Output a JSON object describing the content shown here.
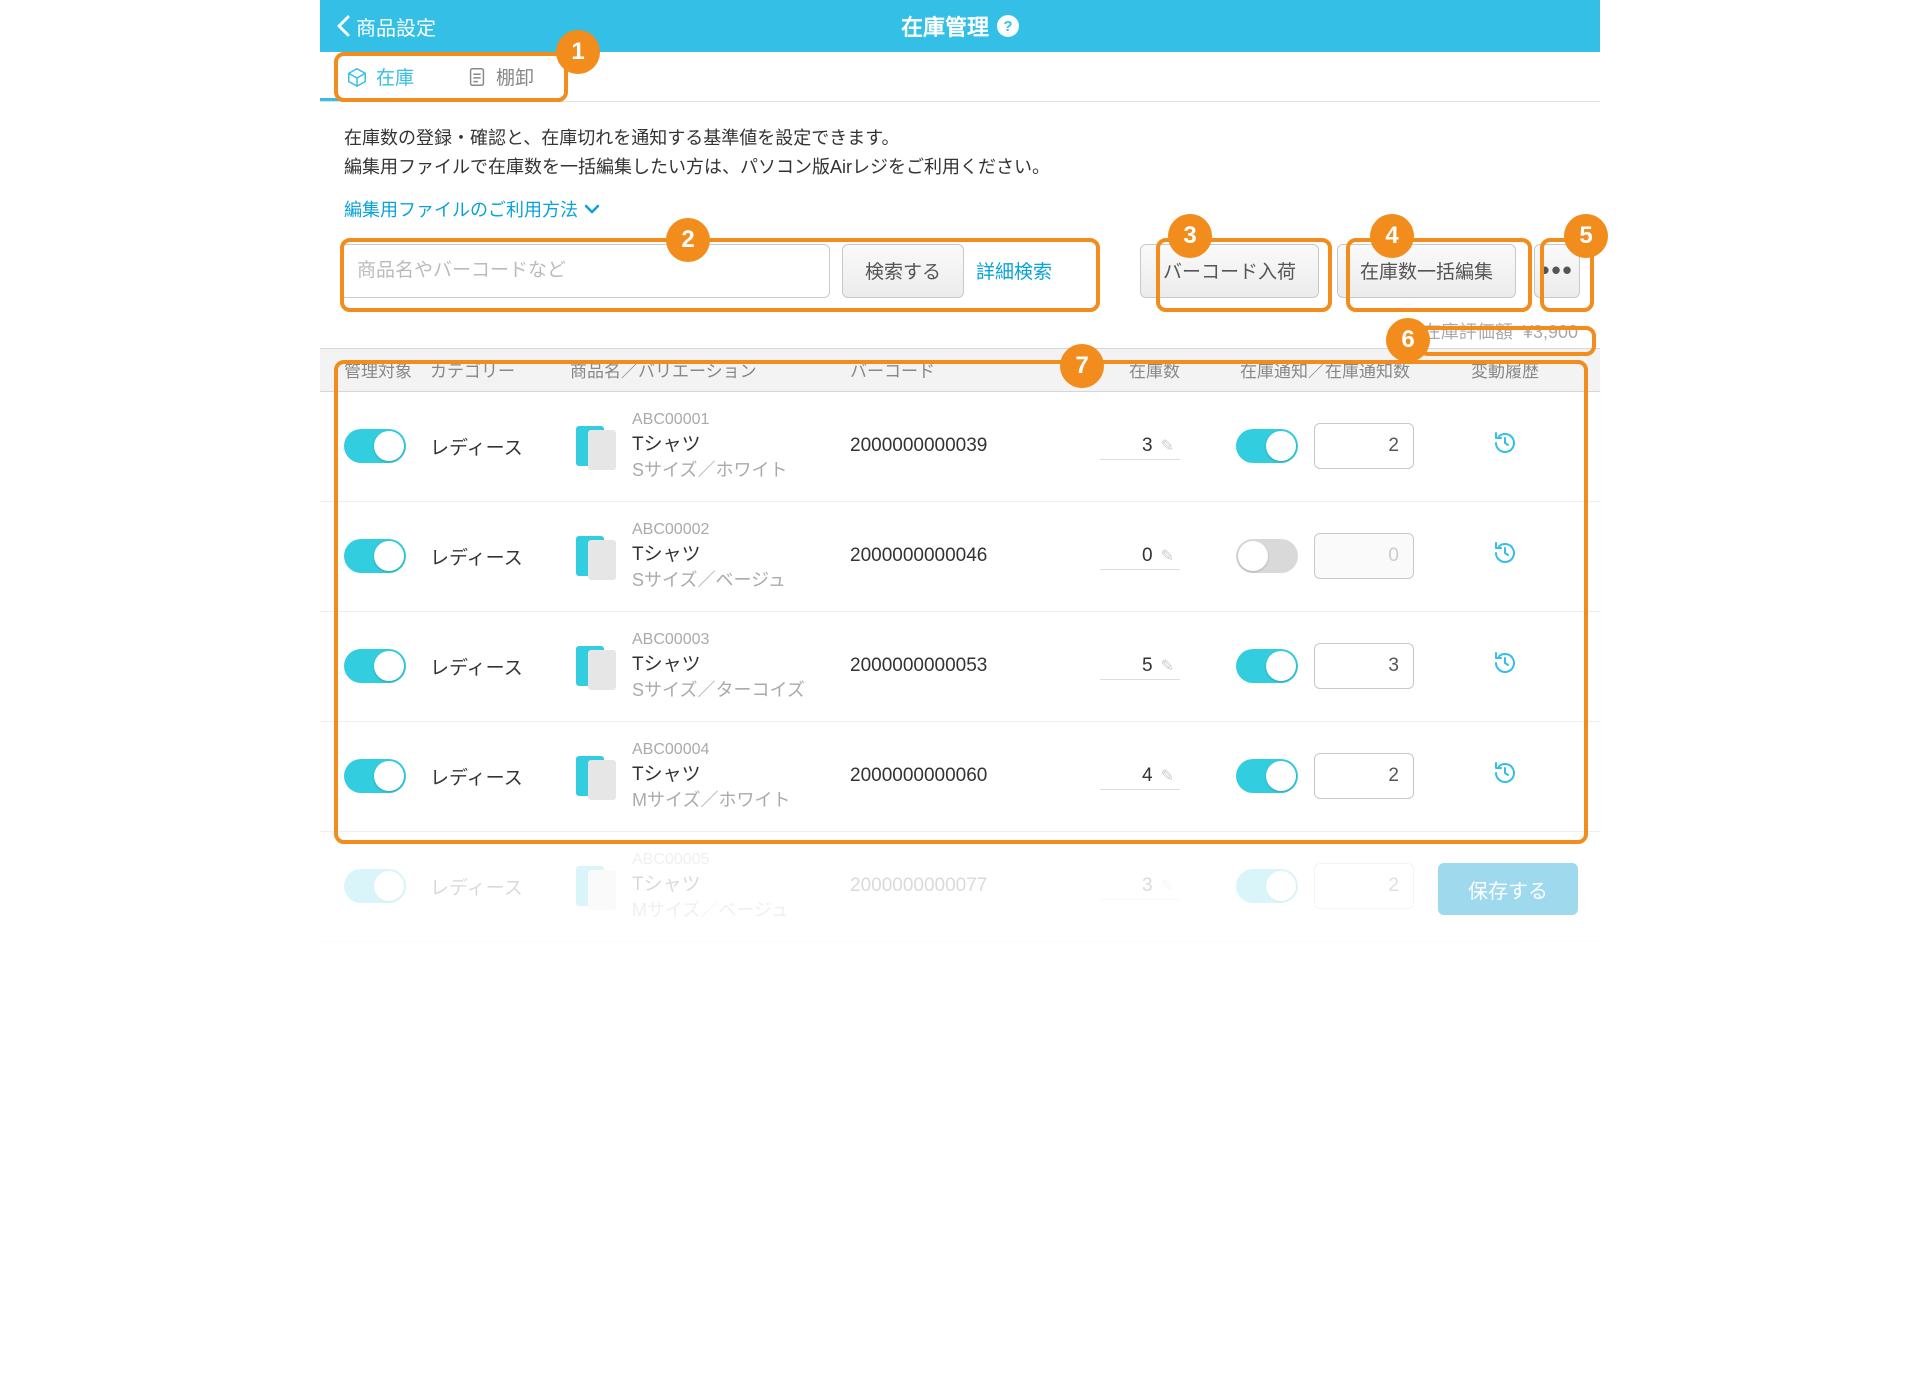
{
  "header": {
    "back": "商品設定",
    "title": "在庫管理"
  },
  "tabs": {
    "stock": "在庫",
    "inventory": "棚卸"
  },
  "description": {
    "line1": "在庫数の登録・確認と、在庫切れを通知する基準値を設定できます。",
    "line2": "編集用ファイルで在庫数を一括編集したい方は、パソコン版Airレジをご利用ください。"
  },
  "link": "編集用ファイルのご利用方法",
  "search": {
    "placeholder": "商品名やバーコードなど",
    "button": "検索する",
    "advanced": "詳細検索"
  },
  "actions": {
    "barcode_in": "バーコード入荷",
    "bulk_edit": "在庫数一括編集"
  },
  "valuation": {
    "label": "在庫評価額",
    "value": "¥3,900"
  },
  "columns": {
    "manage": "管理対象",
    "category": "カテゴリー",
    "name": "商品名／バリエーション",
    "barcode": "バーコード",
    "stock": "在庫数",
    "notify": "在庫通知／在庫通知数",
    "history": "変動履歴"
  },
  "rows": [
    {
      "manage": true,
      "category": "レディース",
      "sku": "ABC00001",
      "pname": "Tシャツ",
      "variant": "Sサイズ／ホワイト",
      "barcode": "2000000000039",
      "stock": "3",
      "notify_on": true,
      "notify_count": "2"
    },
    {
      "manage": true,
      "category": "レディース",
      "sku": "ABC00002",
      "pname": "Tシャツ",
      "variant": "Sサイズ／ベージュ",
      "barcode": "2000000000046",
      "stock": "0",
      "notify_on": false,
      "notify_count": "0"
    },
    {
      "manage": true,
      "category": "レディース",
      "sku": "ABC00003",
      "pname": "Tシャツ",
      "variant": "Sサイズ／ターコイズ",
      "barcode": "2000000000053",
      "stock": "5",
      "notify_on": true,
      "notify_count": "3"
    },
    {
      "manage": true,
      "category": "レディース",
      "sku": "ABC00004",
      "pname": "Tシャツ",
      "variant": "Mサイズ／ホワイト",
      "barcode": "2000000000060",
      "stock": "4",
      "notify_on": true,
      "notify_count": "2"
    },
    {
      "manage": true,
      "category": "レディース",
      "sku": "ABC00005",
      "pname": "Tシャツ",
      "variant": "Mサイズ／ベージュ",
      "barcode": "2000000000077",
      "stock": "3",
      "notify_on": true,
      "notify_count": "2"
    }
  ],
  "save": "保存する",
  "badges": [
    "1",
    "2",
    "3",
    "4",
    "5",
    "6",
    "7"
  ]
}
